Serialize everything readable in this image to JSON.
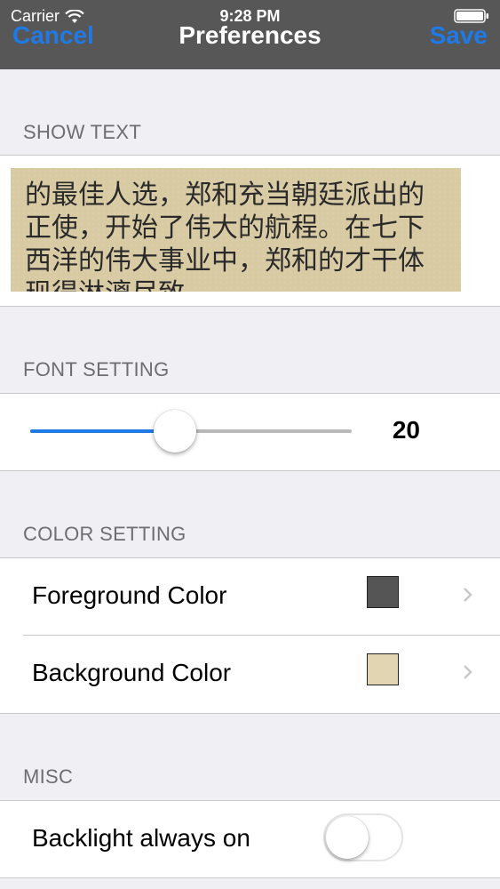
{
  "status_bar": {
    "carrier": "Carrier",
    "time": "9:28 PM",
    "wifi_icon": "wifi-icon",
    "battery_icon": "battery-icon"
  },
  "nav": {
    "left_label": "Cancel",
    "title": "Preferences",
    "right_label": "Save",
    "accent_color": "#1f7ae6"
  },
  "show_text": {
    "header": "SHOW TEXT",
    "preview_text": "的最佳人选，郑和充当朝廷派出的正使，开始了伟大的航程。在七下西洋的伟大事业中，郑和的才干体现得淋漓尽致"
  },
  "font_setting": {
    "header": "FONT SETTING",
    "value": "20",
    "slider_fraction": 0.45
  },
  "color_setting": {
    "header": "COLOR SETTING",
    "rows": [
      {
        "label": "Foreground Color",
        "swatch_color": "#555555"
      },
      {
        "label": "Background Color",
        "swatch_color": "#e2d6b2"
      }
    ]
  },
  "misc": {
    "header": "MISC",
    "backlight_label": "Backlight always on",
    "backlight_on": false
  }
}
